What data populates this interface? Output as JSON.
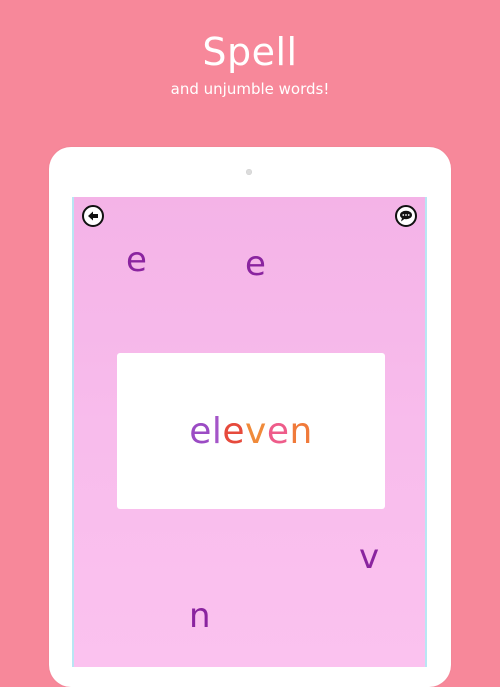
{
  "header": {
    "title": "Spell",
    "subtitle": "and unjumble words!"
  },
  "game": {
    "scattered_letters": [
      {
        "char": "e",
        "color": "#8a249f"
      },
      {
        "char": "e",
        "color": "#8a249f"
      },
      {
        "char": "v",
        "color": "#8a249f"
      },
      {
        "char": "n",
        "color": "#8a249f"
      }
    ],
    "word_card": {
      "letters": [
        {
          "char": "e",
          "color": "#9b4bc4"
        },
        {
          "char": "l",
          "color": "#a455c8"
        },
        {
          "char": "e",
          "color": "#e64a3c"
        },
        {
          "char": "v",
          "color": "#f08a3a"
        },
        {
          "char": "e",
          "color": "#ee5c8a"
        },
        {
          "char": "n",
          "color": "#f07a3a"
        }
      ]
    },
    "icons": {
      "back": "back-arrow-icon",
      "chat": "speech-bubble-icon"
    }
  }
}
